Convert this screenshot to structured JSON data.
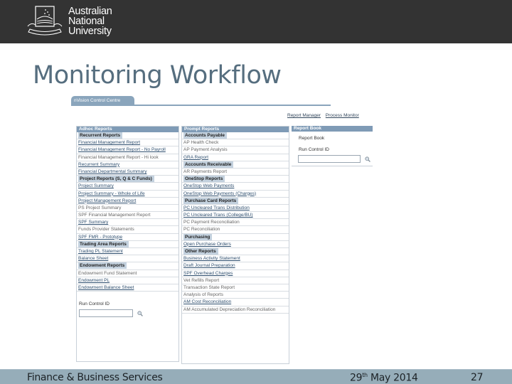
{
  "header": {
    "logo_icon": "anu-crest-icon",
    "university_name": [
      "Australian",
      "National",
      "University"
    ]
  },
  "slide": {
    "title": "Monitoring Workflow"
  },
  "app": {
    "tab_label": "nVision Control Centre",
    "top_links": [
      "Report Manager",
      "Process Monitor"
    ],
    "adhoc": {
      "title": "Adhoc Reports",
      "rows": [
        {
          "text": "Recurrent Reports",
          "type": "sec"
        },
        {
          "text": "Financial Management Report",
          "type": "link"
        },
        {
          "text": "Financial Management Report - No Payroll",
          "type": "link"
        },
        {
          "text": "Financial Management Report - Hi look",
          "type": "plain"
        },
        {
          "text": "Recurrent Summary",
          "type": "link"
        },
        {
          "text": "Financial Departmental Summary",
          "type": "link"
        },
        {
          "text": "Project Reports (S, Q & C Funds)",
          "type": "sec"
        },
        {
          "text": "Project Summary",
          "type": "link"
        },
        {
          "text": "Project Summary - Whole of Life",
          "type": "link"
        },
        {
          "text": "Project Management Report",
          "type": "link"
        },
        {
          "text": "PS Project Summary",
          "type": "plain"
        },
        {
          "text": "SPF Financial Management Report",
          "type": "plain"
        },
        {
          "text": "SPF Summary",
          "type": "link"
        },
        {
          "text": "Funds Provider Statements",
          "type": "plain"
        },
        {
          "text": "SPF FMR - Prototype",
          "type": "link"
        },
        {
          "text": "Trading Area Reports",
          "type": "sec"
        },
        {
          "text": "Trading PL Statement",
          "type": "link"
        },
        {
          "text": "Balance Sheet",
          "type": "link"
        },
        {
          "text": "Endowment Reports",
          "type": "sec"
        },
        {
          "text": "Endowment Fund Statement",
          "type": "plain"
        },
        {
          "text": "Endowment PL",
          "type": "link"
        },
        {
          "text": "Endowment Balance Sheet",
          "type": "link"
        }
      ],
      "run_control_label": "Run Control ID",
      "run_control_value": ""
    },
    "prompt": {
      "title": "Prompt Reports",
      "rows": [
        {
          "text": "Accounts Payable",
          "type": "sec"
        },
        {
          "text": "AP Health Check",
          "type": "plain"
        },
        {
          "text": "AP Payment Analysis",
          "type": "plain"
        },
        {
          "text": "GRA Report",
          "type": "link"
        },
        {
          "text": "Accounts Receivable",
          "type": "sec"
        },
        {
          "text": "AR Payments Report",
          "type": "plain"
        },
        {
          "text": "OneStop Reports",
          "type": "sec"
        },
        {
          "text": "OneStop Web Payments",
          "type": "link"
        },
        {
          "text": "OneStop Web Payments (Charges)",
          "type": "link"
        },
        {
          "text": "Purchase Card Reports",
          "type": "sec"
        },
        {
          "text": "PC Uncleared Trans Distribution",
          "type": "link"
        },
        {
          "text": "PC Uncleared Trans (College/BU)",
          "type": "link"
        },
        {
          "text": "PC Payment Reconciliation",
          "type": "plain"
        },
        {
          "text": "PC Reconciliation",
          "type": "plain"
        },
        {
          "text": "Purchasing",
          "type": "sec"
        },
        {
          "text": "Open Purchase Orders",
          "type": "link"
        },
        {
          "text": "Other Reports",
          "type": "sec"
        },
        {
          "text": "Business Activity Statement",
          "type": "link"
        },
        {
          "text": "Draft Journal Preparation",
          "type": "link"
        },
        {
          "text": "SPF Overhead Charges",
          "type": "link"
        },
        {
          "text": "Vet Refills Report",
          "type": "plain"
        },
        {
          "text": "Transaction State Report",
          "type": "plain"
        },
        {
          "text": "Analysis of Reports",
          "type": "plain"
        },
        {
          "text": "AM Cost Reconciliation",
          "type": "link"
        },
        {
          "text": "AM Accumulated Depreciation Reconciliation",
          "type": "plain"
        }
      ]
    },
    "reportbook": {
      "title": "Report Book",
      "item": "Report Book",
      "run_control_label": "Run Control ID",
      "run_control_value": ""
    },
    "search_icon": "magnifier-icon"
  },
  "footer": {
    "department": "Finance & Business Services",
    "date_day": "29",
    "date_suffix": "th",
    "date_rest": " May 2014",
    "page_number": "27"
  }
}
